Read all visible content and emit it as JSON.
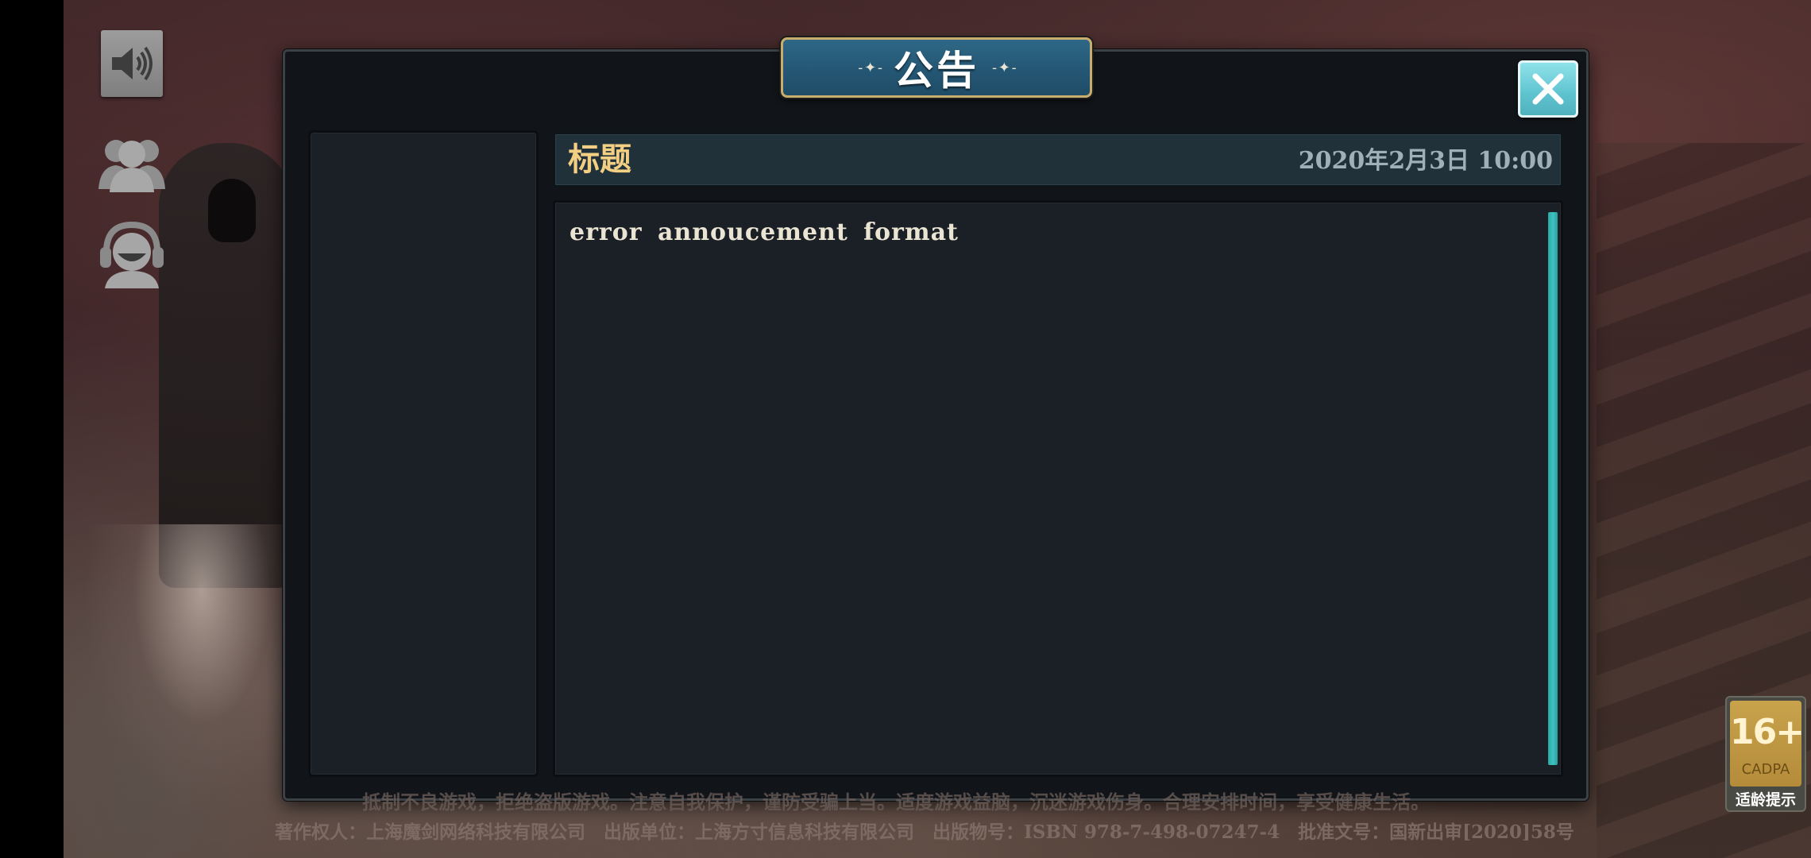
{
  "modal": {
    "title": "公告",
    "title_deco_left": "- ✦ -",
    "title_deco_right": "- ✦ -"
  },
  "notice": {
    "title": "标题",
    "date": "2020年2月3日  10:00",
    "body": "error annoucement format"
  },
  "footer": {
    "line1": "抵制不良游戏，拒绝盗版游戏。注意自我保护，谨防受骗上当。适度游戏益脑，沉迷游戏伤身。合理安排时间，享受健康生活。",
    "line2": "著作权人：上海魔剑网络科技有限公司　出版单位：上海方寸信息科技有限公司　出版物号：ISBN 978-7-498-07247-4　批准文号：国新出审[2020]58号"
  },
  "age_badge": {
    "rating": "16+",
    "org": "CADPA",
    "hint": "适龄提示"
  },
  "icons": {
    "sound": "speaker-icon",
    "friends": "friends-icon",
    "support": "customer-service-icon",
    "close": "close-icon"
  },
  "colors": {
    "title_bar": "#245774",
    "title_border": "#c8ad6d",
    "notice_title": "#f2cf82",
    "close_button": "#5fc3cf",
    "scrollbar": "#3fc2c0"
  }
}
